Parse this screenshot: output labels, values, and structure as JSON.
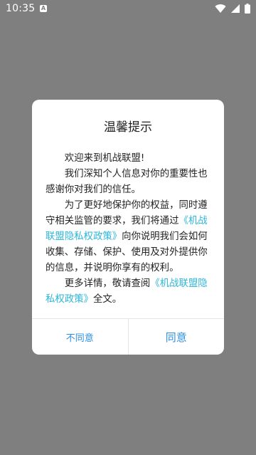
{
  "status_bar": {
    "time": "10:35",
    "notification_icon": "A",
    "icons": [
      "wifi-icon",
      "signal-icon",
      "battery-icon"
    ]
  },
  "dialog": {
    "title": "温馨提示",
    "p1": "欢迎来到机战联盟!",
    "p2": "我们深知个人信息对你的重要性也感谢你对我们的信任。",
    "p3_a": "为了更好地保护你的权益，同时遵守相关监管的要求，我们将通过",
    "policy_link": "《机战联盟隐私权政策》",
    "p3_b": "向你说明我们会如何收集、存储、保护、使用及对外提供你的信息，并说明你享有的权利。",
    "p4_a": "更多详情，敬请查阅",
    "p4_b": "全文。",
    "disagree_label": "不同意",
    "agree_label": "同意"
  },
  "colors": {
    "overlay": "#7f7f7f",
    "link": "#2bb6d8",
    "button_text": "#2b8fe3"
  }
}
